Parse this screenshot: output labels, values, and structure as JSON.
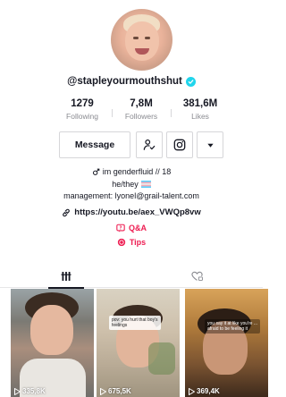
{
  "profile": {
    "username": "@stapleyourmouthshut",
    "verified_icon": "verified-check-icon",
    "stats": [
      {
        "value": "1279",
        "label": "Following"
      },
      {
        "value": "7,8M",
        "label": "Followers"
      },
      {
        "value": "381,6M",
        "label": "Likes"
      }
    ],
    "actions": {
      "message_label": "Message",
      "follow_icon": "person-check-icon",
      "instagram_icon": "instagram-icon",
      "more_icon": "caret-down-icon"
    },
    "bio": {
      "line1": "im genderfluid // 18",
      "line2": "he/they",
      "line3": "management: lyonel@grail-talent.com"
    },
    "link": "https://youtu.be/aex_VWQp8vw",
    "qna_label": "Q&A",
    "tips_label": "Tips"
  },
  "tabs": [
    {
      "name": "videos",
      "icon": "grid-icon",
      "active": true
    },
    {
      "name": "liked",
      "icon": "heart-locked-icon",
      "active": false
    }
  ],
  "videos": [
    {
      "views": "335,8K",
      "caption": ""
    },
    {
      "views": "675,5K",
      "caption": "pov: you hurt that boy's feelings"
    },
    {
      "views": "369,4K",
      "caption": "you say it at like you're ... afraid to be feeling it"
    }
  ],
  "colors": {
    "accent": "#ee1d52",
    "verified": "#20d5ec",
    "text": "#161823",
    "muted": "#8a8b91"
  }
}
